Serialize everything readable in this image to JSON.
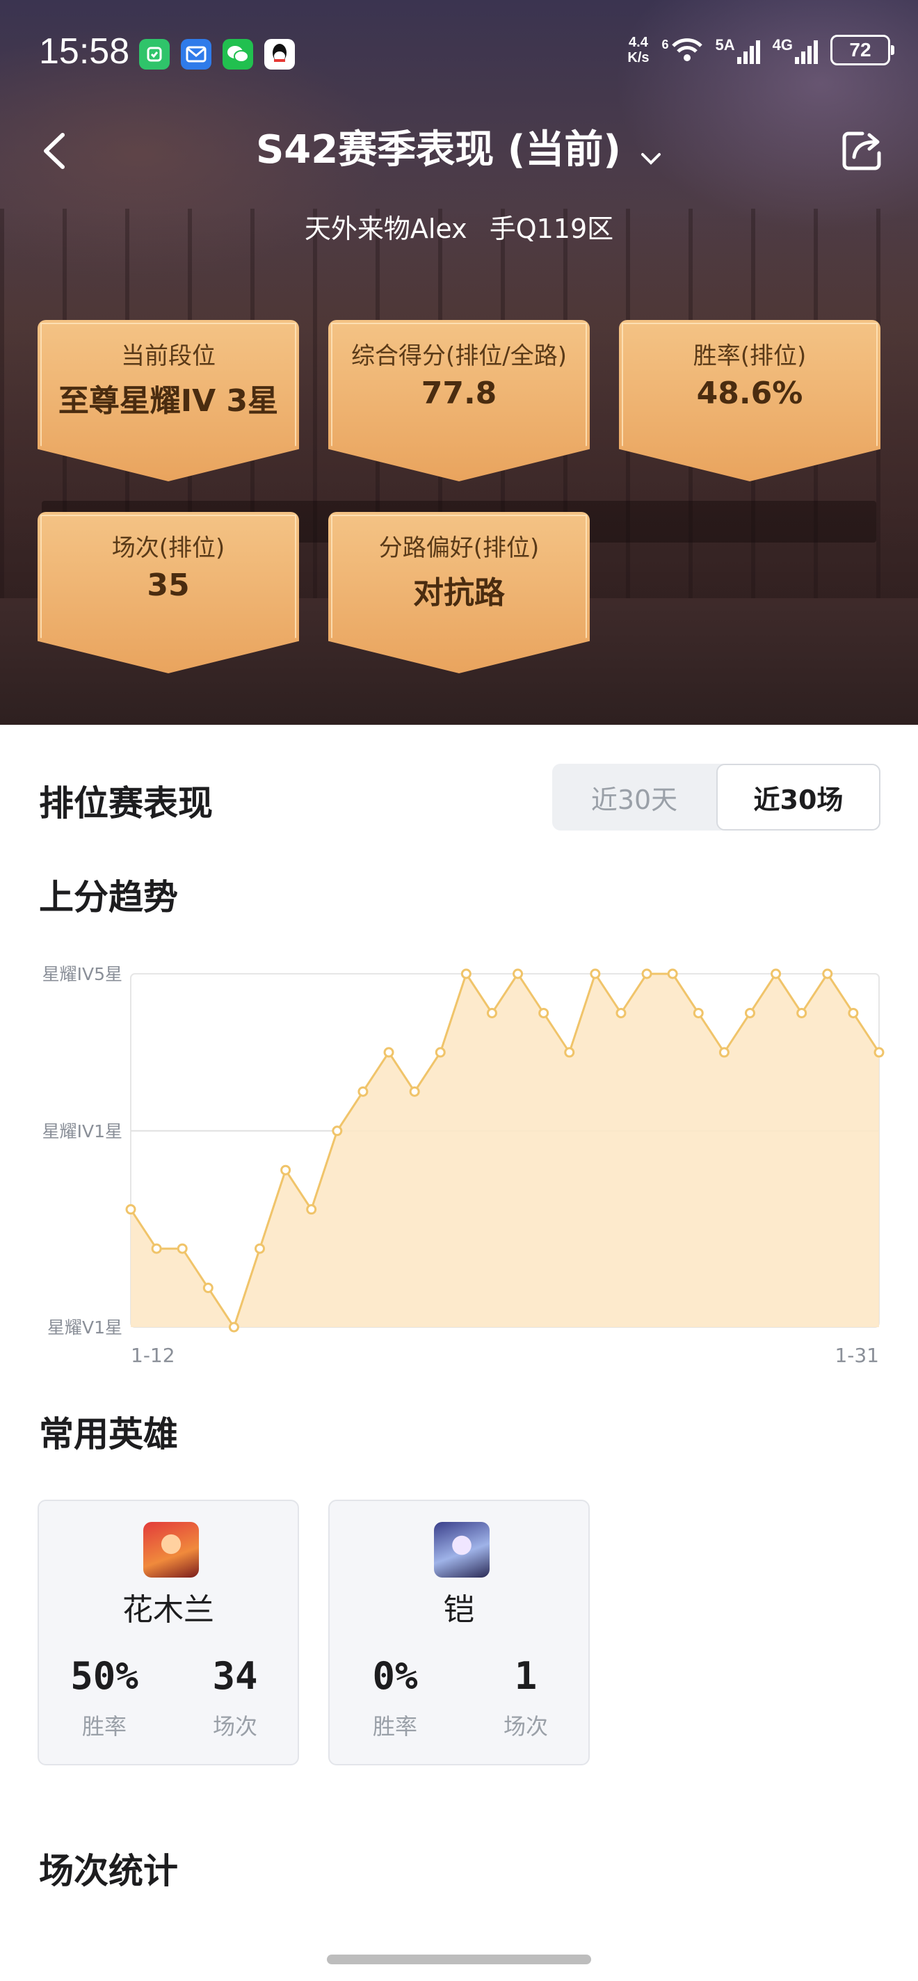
{
  "status_bar": {
    "time": "15:58",
    "net_speed_value": "4.4",
    "net_speed_unit": "K/s",
    "wifi_badge": "6",
    "sim1": "5A",
    "sim2": "4G",
    "battery": "72",
    "apps": [
      "mi-home-icon",
      "mail-icon",
      "wechat-icon",
      "qq-icon"
    ]
  },
  "header": {
    "title": "S42赛季表现 (当前)",
    "player": "天外来物Alex",
    "server": "手Q119区"
  },
  "stats": [
    {
      "label": "当前段位",
      "value": "至尊星耀IV 3星"
    },
    {
      "label": "综合得分(排位/全路)",
      "value": "77.8"
    },
    {
      "label": "胜率(排位)",
      "value": "48.6%"
    },
    {
      "label": "场次(排位)",
      "value": "35"
    },
    {
      "label": "分路偏好(排位)",
      "value": "对抗路"
    }
  ],
  "ranked": {
    "title": "排位赛表现",
    "tabs": [
      "近30天",
      "近30场"
    ],
    "active_tab": "近30场"
  },
  "trend_title": "上分趋势",
  "chart_data": {
    "type": "area",
    "y_tick_labels": [
      "星耀V1星",
      "星耀IV1星",
      "星耀IV5星"
    ],
    "y_tick_values": [
      0,
      5,
      9
    ],
    "x_start_label": "1-12",
    "x_end_label": "1-31",
    "ylim": [
      0,
      9
    ],
    "values": [
      3,
      2,
      2,
      1,
      0,
      2,
      4,
      3,
      5,
      6,
      7,
      6,
      7,
      9,
      8,
      9,
      8,
      7,
      9,
      8,
      9,
      9,
      8,
      7,
      8,
      9,
      8,
      9,
      8,
      7
    ],
    "grid": true,
    "line_color": "#f0c46a",
    "fill_color": "#fde8c6"
  },
  "heroes_title": "常用英雄",
  "heroes": [
    {
      "name": "花木兰",
      "win_rate": "50%",
      "win_rate_label": "胜率",
      "games": "34",
      "games_label": "场次"
    },
    {
      "name": "铠",
      "win_rate": "0%",
      "win_rate_label": "胜率",
      "games": "1",
      "games_label": "场次"
    }
  ],
  "match_stats_title": "场次统计"
}
